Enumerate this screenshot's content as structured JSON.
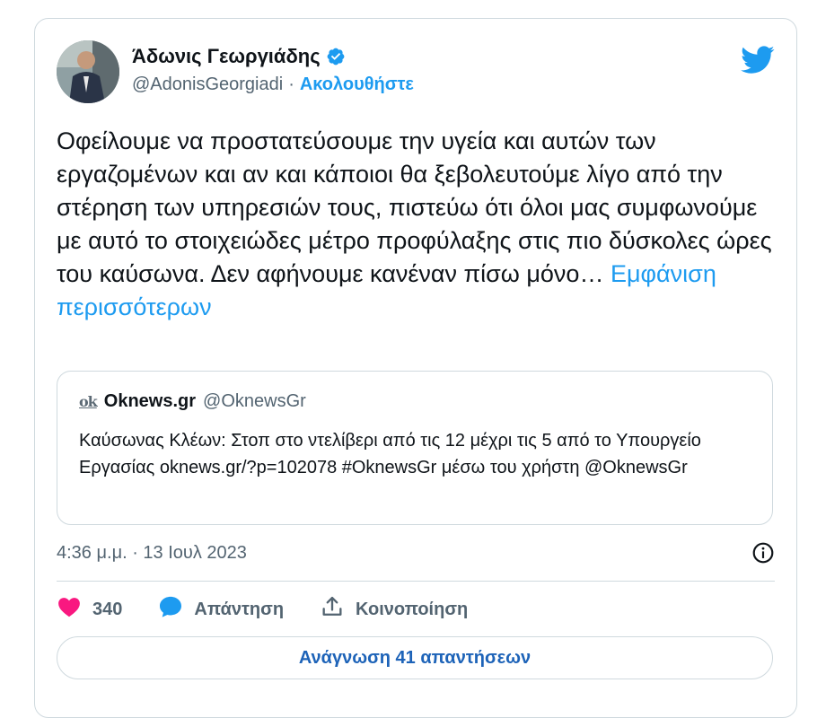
{
  "author": {
    "name": "Άδωνις Γεωργιάδης",
    "handle": "@AdonisGeorgiadi",
    "separator": "·",
    "follow_label": "Ακολουθήστε"
  },
  "tweet": {
    "text": "Οφείλουμε να προστατεύσουμε την υγεία και αυτών των εργαζομένων και αν και κάποιοι θα ξεβολευτούμε λίγο από την στέρηση των υπηρεσιών τους, πιστεύω ότι όλοι μας συμφωνούμε με αυτό το στοιχειώδες μέτρο προφύλαξης στις πιο δύσκολες ώρες του καύσωνα. Δεν αφήνουμε κανέναν πίσω μόνο…",
    "show_more_label": "Εμφάνιση περισσότερων"
  },
  "quote": {
    "logo_text": "ok",
    "name": "Oknews.gr",
    "handle": "@OknewsGr",
    "text": "Καύσωνας Κλέων: Στοπ στο ντελίβερι από τις 12 μέχρι τις 5 από το Υπουργείο Εργασίας oknews.gr/?p=102078 #OknewsGr μέσω του χρήστη @OknewsGr"
  },
  "meta": {
    "timestamp": "4:36 μ.μ. · 13 Ιουλ 2023"
  },
  "actions": {
    "likes_count": "340",
    "reply_label": "Απάντηση",
    "share_label": "Κοινοποίηση"
  },
  "footer": {
    "read_replies_label": "Ανάγνωση 41 απαντήσεων"
  },
  "colors": {
    "accent": "#1d9bf0",
    "like": "#f91880",
    "text": "#0f1419",
    "muted": "#536471",
    "border": "#cfd9de"
  },
  "icons": [
    "verified-badge-icon",
    "twitter-bird-icon",
    "info-icon",
    "heart-icon",
    "reply-bubble-icon",
    "share-icon"
  ]
}
